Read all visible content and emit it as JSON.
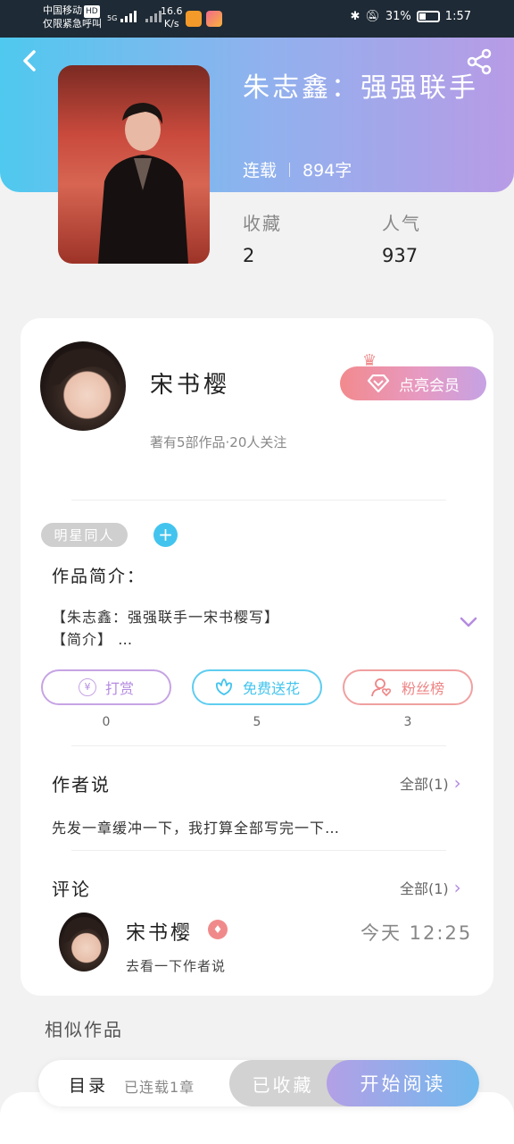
{
  "status_bar": {
    "carrier": "中国移动",
    "carrier_badge": "HD",
    "emergency": "仅限紧急呼叫",
    "network": "5G",
    "speed_value": "16.6",
    "speed_unit": "K/s",
    "battery": "31%",
    "battery_level": 0.31,
    "time": "1:57"
  },
  "book": {
    "title": "朱志鑫：强强联手",
    "status": "连载",
    "word_count": "894字",
    "favorites_label": "收藏",
    "favorites_value": "2",
    "popularity_label": "人气",
    "popularity_value": "937"
  },
  "author": {
    "name": "宋书樱",
    "stats": "著有5部作品·20人关注",
    "vip_button": "点亮会员"
  },
  "tag": {
    "label": "明星同人",
    "add": "+"
  },
  "intro": {
    "title": "作品简介：",
    "line1": "【朱志鑫：强强联手一宋书樱写】",
    "line2": "【简介】 …"
  },
  "actions": {
    "reward": {
      "label": "打赏",
      "count": "0",
      "icon": "¥"
    },
    "flower": {
      "label": "免费送花",
      "count": "5"
    },
    "fans": {
      "label": "粉丝榜",
      "count": "3"
    }
  },
  "author_say": {
    "title": "作者说",
    "more": "全部(1)",
    "text": "先发一章缓冲一下，我打算全部写完一下…"
  },
  "comments": {
    "title": "评论",
    "more": "全部(1)",
    "items": [
      {
        "name": "宋书樱",
        "time": "今天 12:25",
        "text": "去看一下作者说"
      }
    ]
  },
  "similar": {
    "title": "相似作品"
  },
  "bottom_bar": {
    "toc": "目录",
    "toc_status": "已连载1章",
    "favorite": "已收藏",
    "read": "开始阅读"
  },
  "colors": {
    "accent_blue": "#43c4ee",
    "accent_purple": "#b58be0",
    "vip_pink": "#f28a8e",
    "reward_border": "#c6a4e4",
    "flower_border": "#5fcdf0",
    "fans_border": "#f0a0a0"
  }
}
